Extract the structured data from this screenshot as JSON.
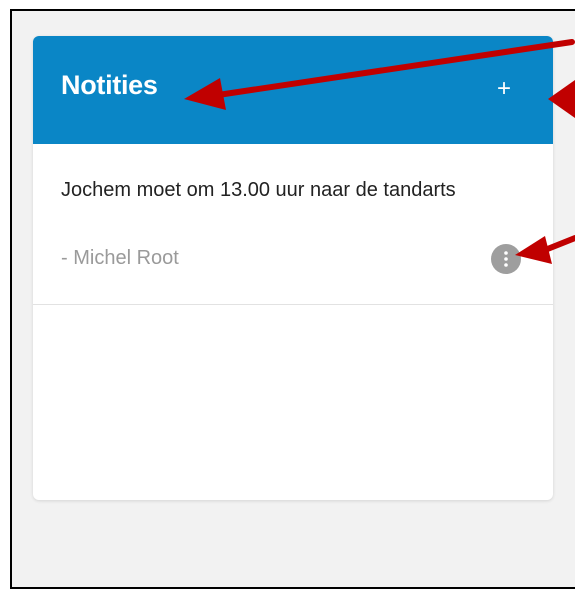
{
  "panel": {
    "title": "Notities",
    "add_label": "+",
    "header_color": "#0a86c6"
  },
  "notes": [
    {
      "text": "Jochem moet om 13.00 uur naar de tandarts",
      "author": "- Michel Root",
      "menu_icon": "more-vertical-icon"
    }
  ],
  "annotations": {
    "arrow_color": "#c00000",
    "arrows": [
      "title-arrow",
      "add-button-arrow",
      "note-menu-arrow"
    ]
  }
}
